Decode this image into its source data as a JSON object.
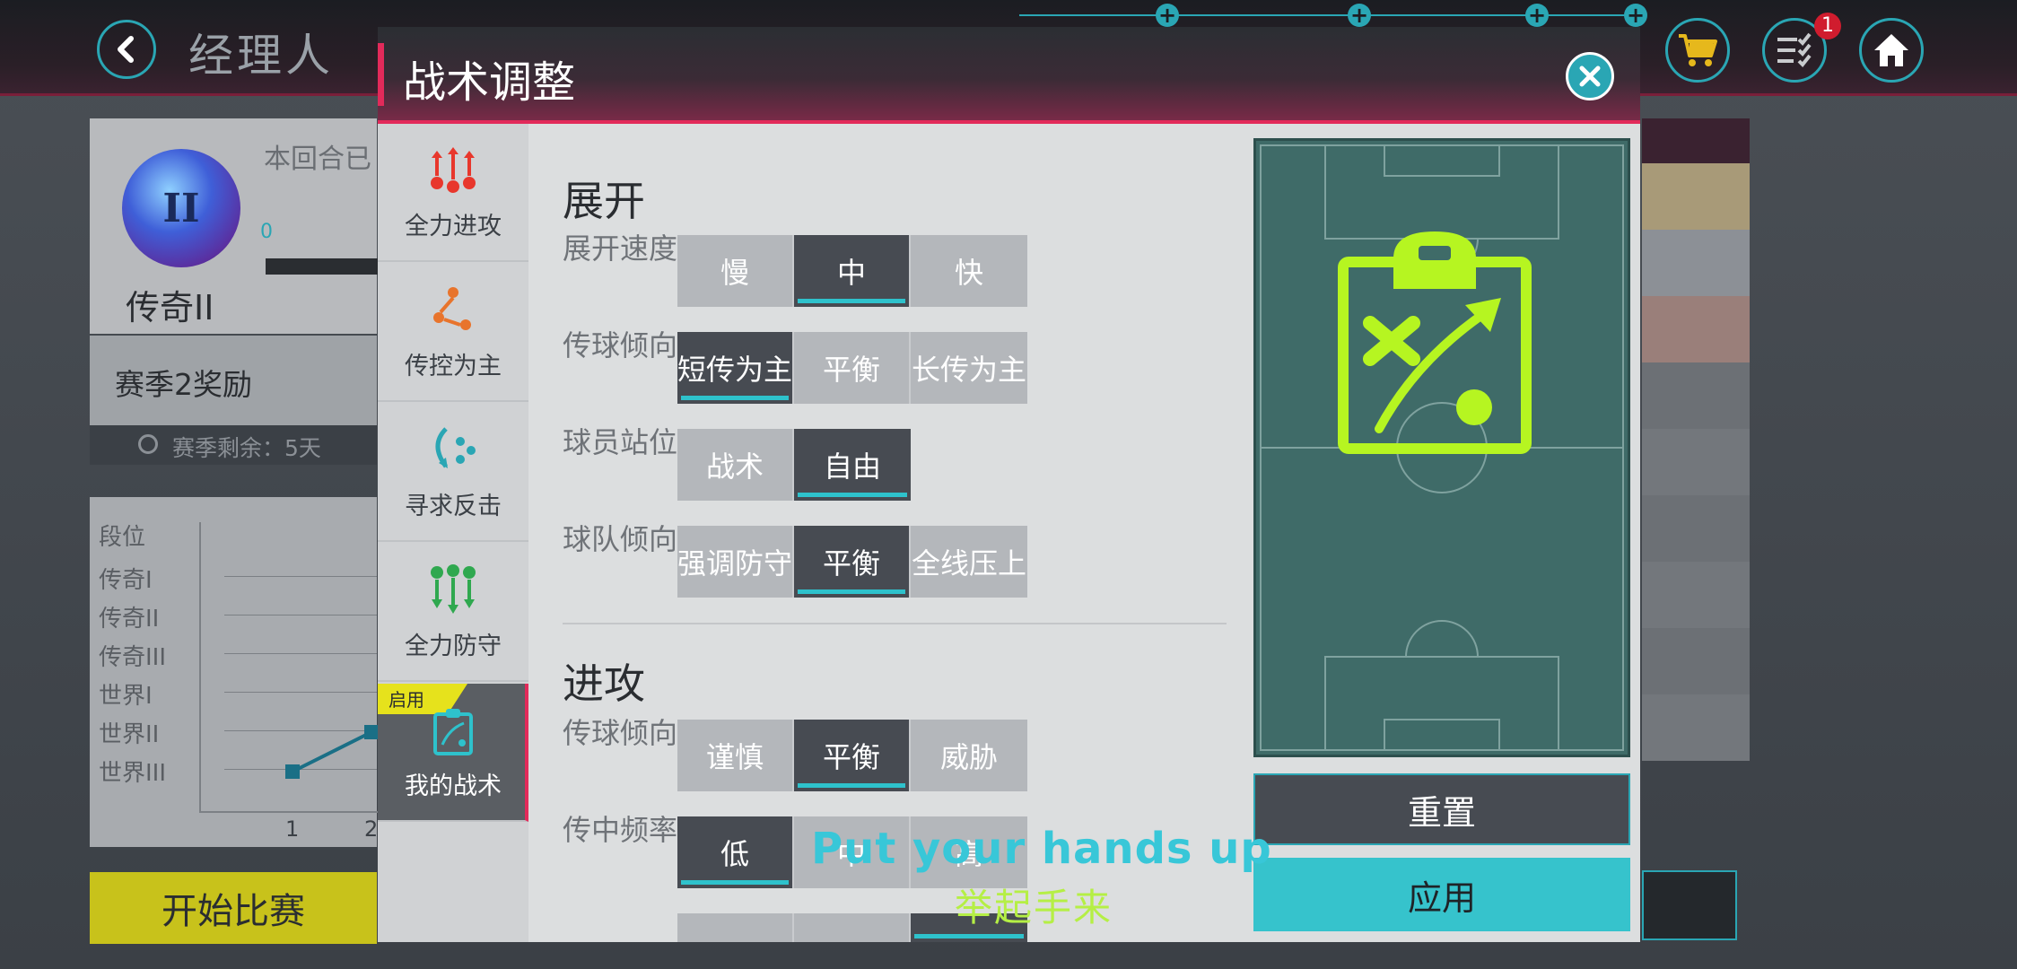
{
  "background": {
    "title": "经理人",
    "rank_name": "传奇II",
    "rank_emblem": "II",
    "round_text": "本回合已",
    "progress_start": "0",
    "season_reward": "赛季2奖励",
    "season_remaining": "赛季剩余：5天",
    "tiers": [
      "段位",
      "传奇I",
      "传奇II",
      "传奇III",
      "世界I",
      "世界II",
      "世界III"
    ],
    "tier_x_ticks": [
      "1",
      "2"
    ],
    "start_button": "开始比赛",
    "notification_count": "1",
    "icons": [
      "back-icon",
      "cart-icon",
      "tasks-icon",
      "home-icon",
      "clock-icon"
    ]
  },
  "modal": {
    "title": "战术调整",
    "sidebar": [
      {
        "label": "全力进攻",
        "icon": "all-out-attack-icon",
        "color": "#e8372c"
      },
      {
        "label": "传控为主",
        "icon": "possession-icon",
        "color": "#e8742c"
      },
      {
        "label": "寻求反击",
        "icon": "counter-attack-icon",
        "color": "#2aa6b4"
      },
      {
        "label": "全力防守",
        "icon": "all-out-defense-icon",
        "color": "#2fa84f"
      },
      {
        "label": "我的战术",
        "icon": "my-tactics-icon",
        "color": "#2ec2cc",
        "tag": "启用"
      }
    ],
    "sections": [
      {
        "title": "展开",
        "rows": [
          {
            "label": "展开速度",
            "options": [
              "慢",
              "中",
              "快"
            ],
            "selected": 1
          },
          {
            "label": "传球倾向",
            "options": [
              "短传为主",
              "平衡",
              "长传为主"
            ],
            "selected": 0
          },
          {
            "label": "球员站位",
            "options": [
              "战术",
              "自由"
            ],
            "selected": 1
          },
          {
            "label": "球队倾向",
            "options": [
              "强调防守",
              "平衡",
              "全线压上"
            ],
            "selected": 1
          }
        ]
      },
      {
        "title": "进攻",
        "rows": [
          {
            "label": "传球倾向",
            "options": [
              "谨慎",
              "平衡",
              "威胁"
            ],
            "selected": 1
          },
          {
            "label": "传中频率",
            "options": [
              "低",
              "中",
              "高"
            ],
            "selected": 0
          }
        ]
      }
    ],
    "reset_button": "重置",
    "apply_button": "应用",
    "colors": {
      "accent": "#2ec2cc",
      "selected": "#474b52",
      "pitch": "#3f6b68",
      "tactic_icon": "#b6f521"
    }
  },
  "overlay": {
    "subtitle_en": "Put your hands up",
    "subtitle_zh": "举起手来"
  }
}
